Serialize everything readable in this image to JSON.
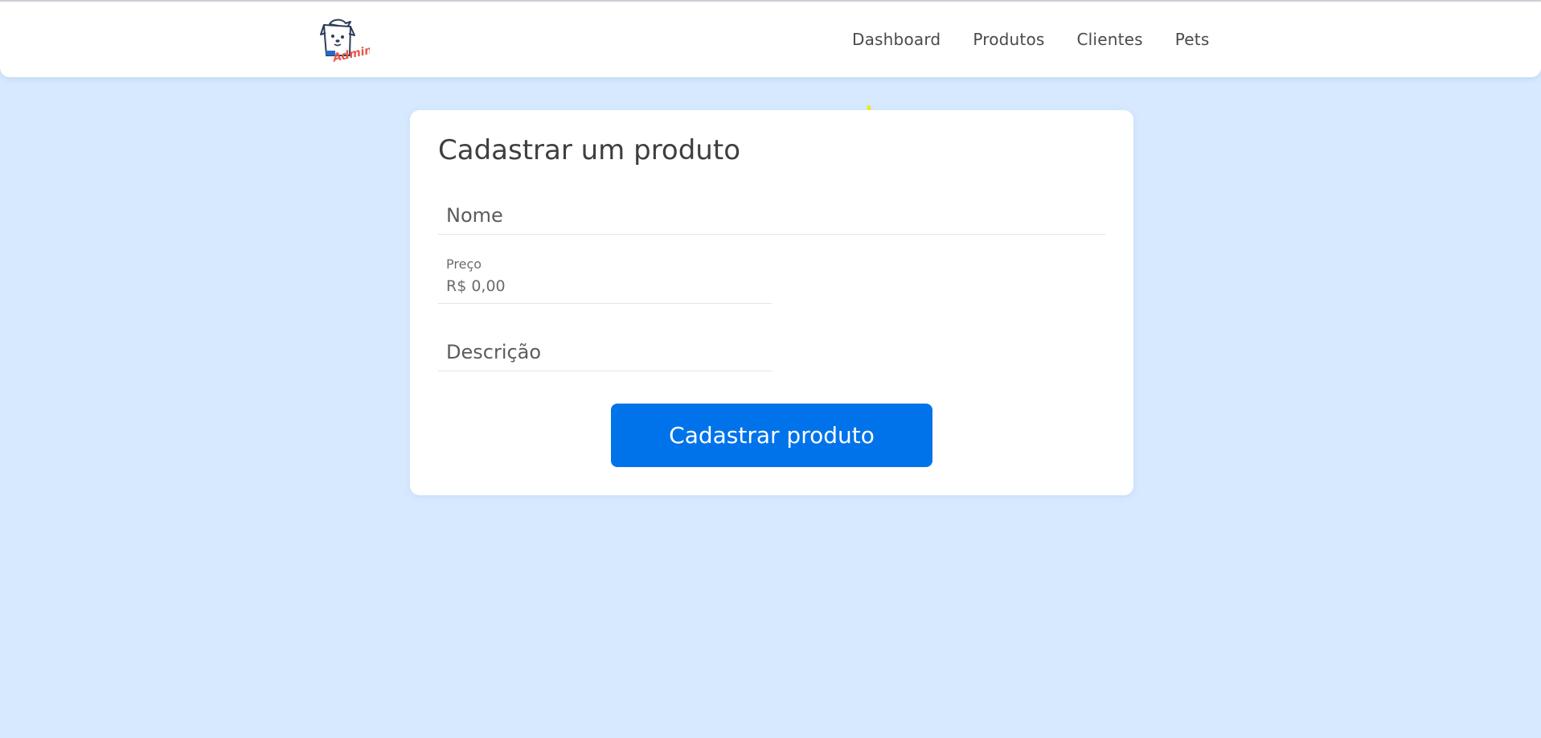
{
  "header": {
    "logo_text": "Admin",
    "nav": [
      "Dashboard",
      "Produtos",
      "Clientes",
      "Pets"
    ]
  },
  "form": {
    "title": "Cadastrar um produto",
    "nome": {
      "placeholder": "Nome"
    },
    "preco": {
      "label": "Preço",
      "value": "R$ 0,00"
    },
    "descricao": {
      "placeholder": "Descrição"
    },
    "submit_label": "Cadastrar produto"
  },
  "colors": {
    "background": "#d6e9ff",
    "accent": "#0073ea",
    "logo_text": "#e8574a"
  }
}
